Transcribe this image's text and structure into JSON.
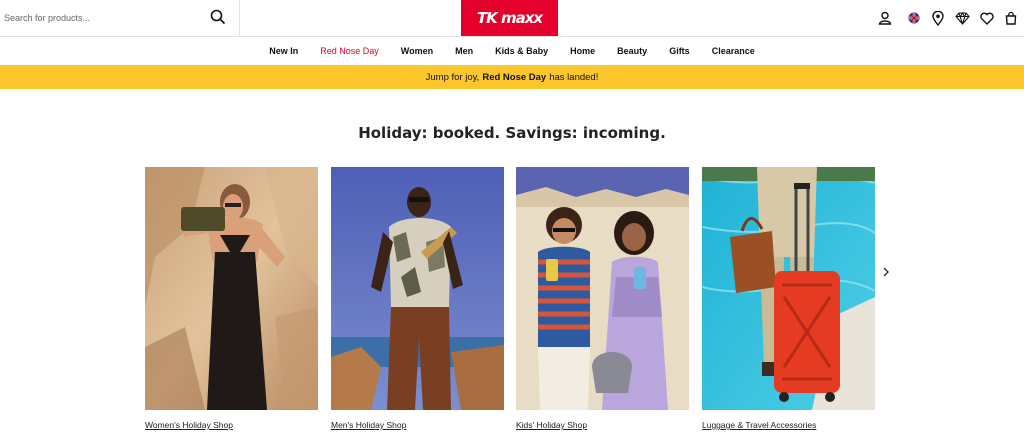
{
  "search": {
    "placeholder": "Search for products..."
  },
  "brand": {
    "logo_text": "TK maxx",
    "color": "#e4002b"
  },
  "header_icons": [
    "account-icon",
    "uk-flag-icon",
    "store-locator-icon",
    "gold-label-icon",
    "wishlist-icon",
    "bag-icon"
  ],
  "nav": [
    {
      "label": "New In"
    },
    {
      "label": "Red Nose Day"
    },
    {
      "label": "Women"
    },
    {
      "label": "Men"
    },
    {
      "label": "Kids & Baby"
    },
    {
      "label": "Home"
    },
    {
      "label": "Beauty"
    },
    {
      "label": "Gifts"
    },
    {
      "label": "Clearance"
    }
  ],
  "banner": {
    "pre": "Jump for joy,",
    "bold": "Red Nose Day",
    "post": "has landed!",
    "color": "#fdc62d"
  },
  "heading": "Holiday: booked. Savings: incoming.",
  "cards": [
    {
      "caption": "Women's Holiday Shop"
    },
    {
      "caption": "Men's Holiday Shop"
    },
    {
      "caption": "Kids' Holiday Shop"
    },
    {
      "caption": "Luggage & Travel Accessories"
    }
  ]
}
